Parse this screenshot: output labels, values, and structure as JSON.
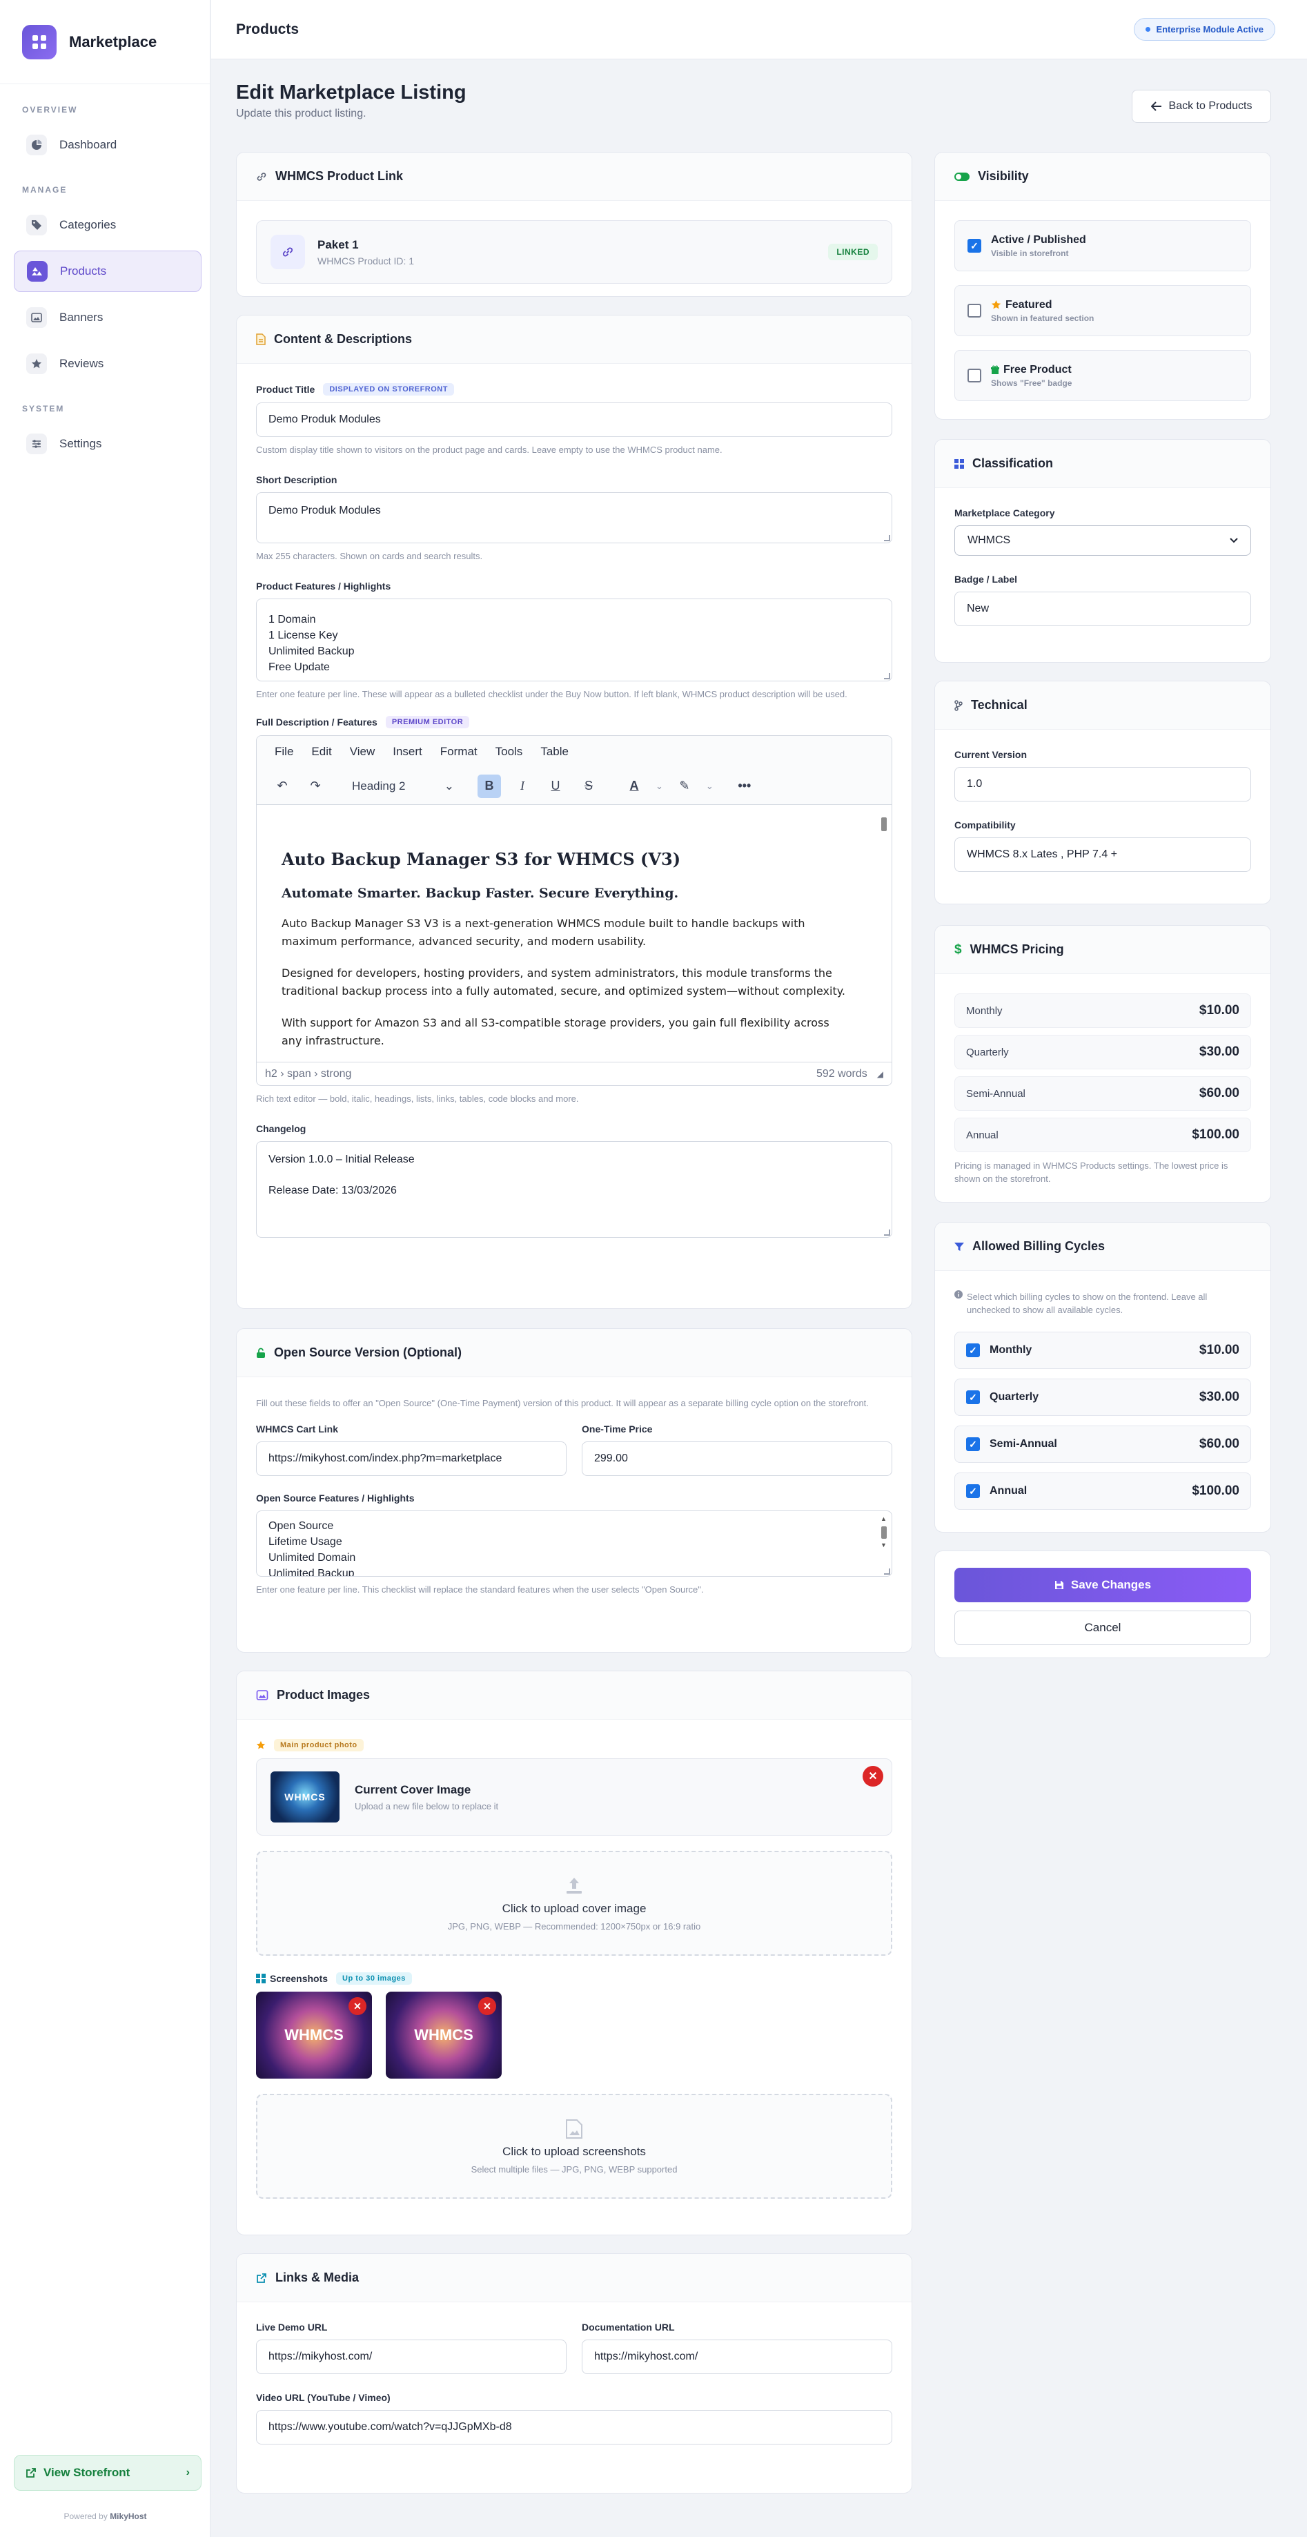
{
  "brand": {
    "name": "Marketplace"
  },
  "nav": {
    "sections": {
      "overview": "OVERVIEW",
      "manage": "MANAGE",
      "system": "SYSTEM"
    },
    "items": [
      {
        "label": "Dashboard",
        "icon": "dashboard-icon"
      },
      {
        "label": "Categories",
        "icon": "tag-icon"
      },
      {
        "label": "Products",
        "icon": "products-icon",
        "active": true
      },
      {
        "label": "Banners",
        "icon": "image-icon"
      },
      {
        "label": "Reviews",
        "icon": "star-icon"
      },
      {
        "label": "Settings",
        "icon": "sliders-icon"
      }
    ],
    "storefront": "View Storefront",
    "powered_prefix": "Powered by",
    "powered_name": "MikyHost"
  },
  "topbar": {
    "title": "Products",
    "pill": "Enterprise Module Active"
  },
  "page": {
    "title": "Edit Marketplace Listing",
    "subtitle": "Update this product listing.",
    "back": "Back to Products"
  },
  "whmcs_link": {
    "header": "WHMCS Product Link",
    "name": "Paket 1",
    "sub": "WHMCS Product ID: 1",
    "badge": "LINKED"
  },
  "content": {
    "header": "Content & Descriptions",
    "title_label": "Product Title",
    "title_tag": "DISPLAYED ON STOREFRONT",
    "title_value": "Demo Produk Modules",
    "title_help": "Custom display title shown to visitors on the product page and cards. Leave empty to use the WHMCS product name.",
    "short_label": "Short Description",
    "short_value": "Demo Produk Modules",
    "short_help": "Max 255 characters. Shown on cards and search results.",
    "features_label": "Product Features / Highlights",
    "features": [
      "1 Domain",
      "1 License Key",
      "Unlimited Backup",
      "Free Update"
    ],
    "features_help": "Enter one feature per line. These will appear as a bulleted checklist under the Buy Now button. If left blank, WHMCS product description will be used.",
    "full_label": "Full Description / Features",
    "full_tag": "PREMIUM EDITOR",
    "editor": {
      "menu": [
        "File",
        "Edit",
        "View",
        "Insert",
        "Format",
        "Tools",
        "Table"
      ],
      "block_format": "Heading 2",
      "h2": "Auto Backup Manager S3 for WHMCS (V3)",
      "h3": "Automate Smarter. Backup Faster. Secure Everything.",
      "p1": "Auto Backup Manager S3 V3 is a next-generation WHMCS module built to handle backups with maximum performance, advanced security, and modern usability.",
      "p2": "Designed for developers, hosting providers, and system administrators, this module transforms the traditional backup process into a fully automated, secure, and optimized system—without complexity.",
      "p3": "With support for Amazon S3 and all S3-compatible storage providers, you gain full flexibility across any infrastructure.",
      "path": "h2 › span › strong",
      "words": "592 words"
    },
    "full_help": "Rich text editor — bold, italic, headings, lists, links, tables, code blocks and more.",
    "changelog_label": "Changelog",
    "changelog_1": "Version 1.0.0 – Initial Release",
    "changelog_2": "Release Date: 13/03/2026"
  },
  "open_source": {
    "header": "Open Source Version (Optional)",
    "intro": "Fill out these fields to offer an \"Open Source\" (One-Time Payment) version of this product. It will appear as a separate billing cycle option on the storefront.",
    "cart_label": "WHMCS Cart Link",
    "cart_value": "https://mikyhost.com/index.php?m=marketplace",
    "price_label": "One-Time Price",
    "price_value": "299.00",
    "features_label": "Open Source Features / Highlights",
    "features": [
      "Open Source",
      "Lifetime Usage",
      "Unlimited Domain",
      "Unlimited Backup"
    ],
    "features_help": "Enter one feature per line. This checklist will replace the standard features when the user selects \"Open Source\"."
  },
  "images": {
    "header": "Product Images",
    "main_tag": "Main product photo",
    "cover_title": "Current Cover Image",
    "cover_sub": "Upload a new file below to replace it",
    "cover_thumb_text": "WHMCS",
    "upload_cover": "Click to upload cover image",
    "upload_cover_sub": "JPG, PNG, WEBP — Recommended: 1200×750px or 16:9 ratio",
    "screens_label": "Screenshots",
    "screens_tag": "Up to 30 images",
    "shot_text": "WHMCS",
    "upload_shots": "Click to upload screenshots",
    "upload_shots_sub": "Select multiple files — JPG, PNG, WEBP supported"
  },
  "links": {
    "header": "Links & Media",
    "demo_label": "Live Demo URL",
    "demo_value": "https://mikyhost.com/",
    "docs_label": "Documentation URL",
    "docs_value": "https://mikyhost.com/",
    "video_label": "Video URL (YouTube / Vimeo)",
    "video_value": "https://www.youtube.com/watch?v=qJJGpMXb-d8"
  },
  "visibility": {
    "header": "Visibility",
    "items": [
      {
        "t1": "Active / Published",
        "t2": "Visible in storefront",
        "checked": true
      },
      {
        "t1": "Featured",
        "t2": "Shown in featured section",
        "checked": false
      },
      {
        "t1": "Free Product",
        "t2": "Shows \"Free\" badge",
        "checked": false
      }
    ]
  },
  "classification": {
    "header": "Classification",
    "cat_label": "Marketplace Category",
    "cat_value": "WHMCS",
    "badge_label": "Badge / Label",
    "badge_value": "New"
  },
  "technical": {
    "header": "Technical",
    "version_label": "Current Version",
    "version_value": "1.0",
    "compat_label": "Compatibility",
    "compat_value": "WHMCS 8.x Lates , PHP 7.4 +"
  },
  "pricing": {
    "header": "WHMCS Pricing",
    "rows": [
      {
        "label": "Monthly",
        "value": "$10.00"
      },
      {
        "label": "Quarterly",
        "value": "$30.00"
      },
      {
        "label": "Semi-Annual",
        "value": "$60.00"
      },
      {
        "label": "Annual",
        "value": "$100.00"
      }
    ],
    "help": "Pricing is managed in WHMCS Products settings. The lowest price is shown on the storefront."
  },
  "cycles": {
    "header": "Allowed Billing Cycles",
    "help": "Select which billing cycles to show on the frontend. Leave all unchecked to show all available cycles.",
    "rows": [
      {
        "label": "Monthly",
        "value": "$10.00"
      },
      {
        "label": "Quarterly",
        "value": "$30.00"
      },
      {
        "label": "Semi-Annual",
        "value": "$60.00"
      },
      {
        "label": "Annual",
        "value": "$100.00"
      }
    ]
  },
  "actions": {
    "save": "Save Changes",
    "cancel": "Cancel"
  },
  "colors": {
    "accent": "#6a56d9",
    "green": "#15803d",
    "danger": "#dc2626",
    "check": "#1a73e8"
  }
}
